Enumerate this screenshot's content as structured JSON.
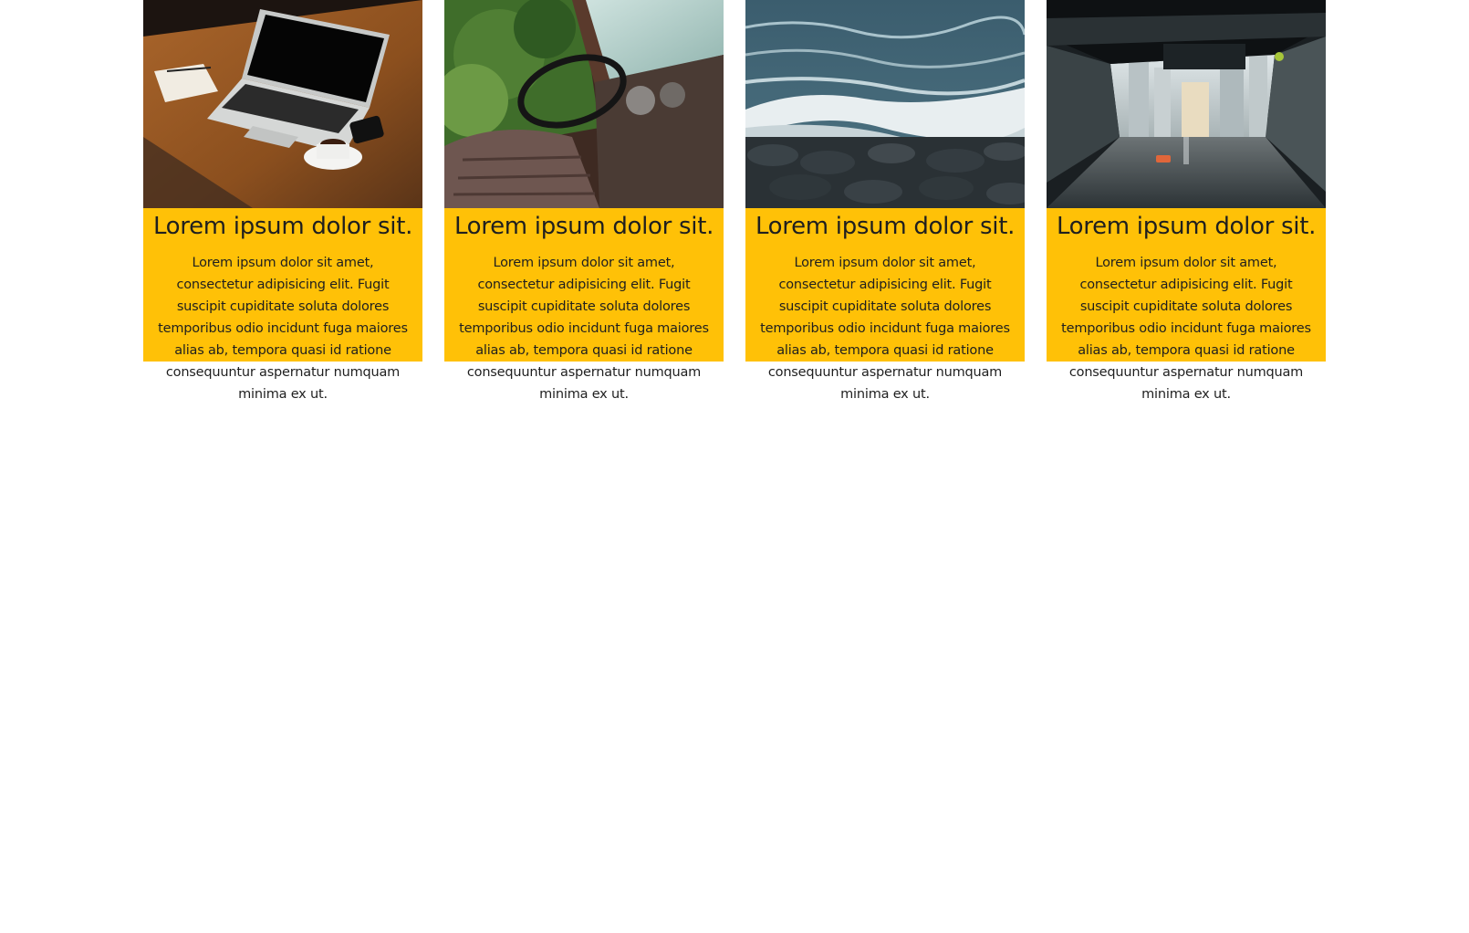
{
  "cards": [
    {
      "image": "laptop-coffee-photo",
      "title": "Lorem ipsum dolor sit.",
      "text": "Lorem ipsum dolor sit amet, consectetur adipisicing elit. Fugit suscipit cupiditate soluta dolores temporibus odio incidunt fuga maiores alias ab, tempora quasi id ratione consequuntur aspernatur numquam minima ex ut."
    },
    {
      "image": "abandoned-truck-interior-photo",
      "title": "Lorem ipsum dolor sit.",
      "text": "Lorem ipsum dolor sit amet, consectetur adipisicing elit. Fugit suscipit cupiditate soluta dolores temporibus odio incidunt fuga maiores alias ab, tempora quasi id ratione consequuntur aspernatur numquam minima ex ut."
    },
    {
      "image": "ocean-waves-rocks-photo",
      "title": "Lorem ipsum dolor sit.",
      "text": "Lorem ipsum dolor sit amet, consectetur adipisicing elit. Fugit suscipit cupiditate soluta dolores temporibus odio incidunt fuga maiores alias ab, tempora quasi id ratione consequuntur aspernatur numquam minima ex ut."
    },
    {
      "image": "city-street-underpass-photo",
      "title": "Lorem ipsum dolor sit.",
      "text": "Lorem ipsum dolor sit amet, consectetur adipisicing elit. Fugit suscipit cupiditate soluta dolores temporibus odio incidunt fuga maiores alias ab, tempora quasi id ratione consequuntur aspernatur numquam minima ex ut."
    }
  ],
  "colors": {
    "card_background": "#ffc107",
    "page_background": "#ffffff",
    "text": "#1f1f1f"
  }
}
